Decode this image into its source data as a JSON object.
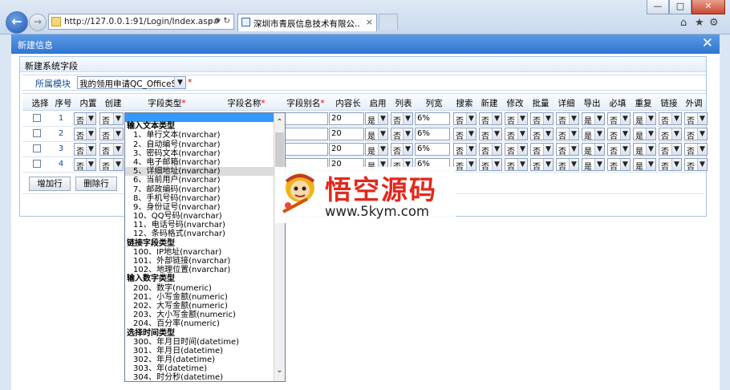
{
  "browser": {
    "url": "http://127.0.0.1:91/Login/Index.asp#",
    "url_tools": "⌕ ▾ ↻",
    "tab_title": "深圳市青辰信息技术有限公...",
    "tab_close": "×",
    "window_buttons": [
      "—",
      "□",
      "✕"
    ],
    "right_icons": [
      "⌂",
      "★",
      "⚙"
    ]
  },
  "dialog": {
    "title": "新建信息",
    "close": "✕",
    "panel_title": "新建系统字段",
    "module_label": "所属模块",
    "module_value": "我的领用申请QC_OfficeSu",
    "required_mark": "*"
  },
  "table": {
    "headers": [
      "选择",
      "序号",
      "内置",
      "创建",
      "字段类型*",
      "字段名称*",
      "字段别名*",
      "内容长",
      "启用",
      "列表",
      "列宽",
      "搜索",
      "新建",
      "修改",
      "批量",
      "详细",
      "导出",
      "必填",
      "重复",
      "链接",
      "外调"
    ],
    "rows": [
      {
        "num": "1",
        "builtin": "否",
        "create": "否",
        "length": "20",
        "enable": "是",
        "list": "否",
        "width": "6%",
        "flags": [
          "否",
          "否",
          "否",
          "否",
          "否",
          "是",
          "否",
          "是",
          "否",
          "否"
        ]
      },
      {
        "num": "2",
        "builtin": "否",
        "create": "否",
        "length": "20",
        "enable": "是",
        "list": "否",
        "width": "6%",
        "flags": [
          "否",
          "否",
          "否",
          "否",
          "否",
          "是",
          "否",
          "是",
          "否",
          "否"
        ]
      },
      {
        "num": "3",
        "builtin": "否",
        "create": "否",
        "length": "20",
        "enable": "是",
        "list": "否",
        "width": "6%",
        "flags": [
          "否",
          "否",
          "否",
          "否",
          "否",
          "是",
          "否",
          "是",
          "否",
          "否"
        ]
      },
      {
        "num": "4",
        "builtin": "否",
        "create": "否",
        "length": "20",
        "enable": "是",
        "list": "否",
        "width": "6%",
        "flags": [
          "否",
          "否",
          "否",
          "否",
          "否",
          "是",
          "否",
          "是",
          "否",
          "否"
        ]
      }
    ],
    "add_row": "增加行",
    "delete_row": "删除行"
  },
  "field_type_options": [
    {
      "text": "",
      "kind": "blank"
    },
    {
      "text": "输入文本类型",
      "kind": "group"
    },
    {
      "text": "1、单行文本(nvarchar)",
      "kind": "item"
    },
    {
      "text": "2、自动编号(nvarchar)",
      "kind": "item"
    },
    {
      "text": "3、密码文本(nvarchar)",
      "kind": "item"
    },
    {
      "text": "4、电子邮箱(nvarchar)",
      "kind": "item"
    },
    {
      "text": "5、详细地址(nvarchar)",
      "kind": "hl"
    },
    {
      "text": "6、当前用户(nvarchar)",
      "kind": "item"
    },
    {
      "text": "7、邮政编码(nvarchar)",
      "kind": "item"
    },
    {
      "text": "8、手机号码(nvarchar)",
      "kind": "item"
    },
    {
      "text": "9、身份证号(nvarchar)",
      "kind": "item"
    },
    {
      "text": "10、QQ号码(nvarchar)",
      "kind": "item"
    },
    {
      "text": "11、电话号码(nvarchar)",
      "kind": "item"
    },
    {
      "text": "12、条码格式(nvarchar)",
      "kind": "item"
    },
    {
      "text": "链接字段类型",
      "kind": "group"
    },
    {
      "text": "100、IP地址(nvarchar)",
      "kind": "item"
    },
    {
      "text": "101、外部链接(nvarchar)",
      "kind": "item"
    },
    {
      "text": "102、地理位置(nvarchar)",
      "kind": "item"
    },
    {
      "text": "输入数字类型",
      "kind": "group"
    },
    {
      "text": "200、数字(numeric)",
      "kind": "item"
    },
    {
      "text": "201、小写金额(numeric)",
      "kind": "item"
    },
    {
      "text": "202、大写金额(numeric)",
      "kind": "item"
    },
    {
      "text": "203、大小写金额(numeric)",
      "kind": "item"
    },
    {
      "text": "204、百分率(numeric)",
      "kind": "item"
    },
    {
      "text": "选择时间类型",
      "kind": "group"
    },
    {
      "text": "300、年月日时间(datetime)",
      "kind": "item"
    },
    {
      "text": "301、年月日(datetime)",
      "kind": "item"
    },
    {
      "text": "302、年月(datetime)",
      "kind": "item"
    },
    {
      "text": "303、年(datetime)",
      "kind": "item"
    },
    {
      "text": "304、时分秒(datetime)",
      "kind": "item"
    }
  ],
  "watermark": {
    "cn": "悟空源码",
    "en": "www.5kym.com"
  }
}
